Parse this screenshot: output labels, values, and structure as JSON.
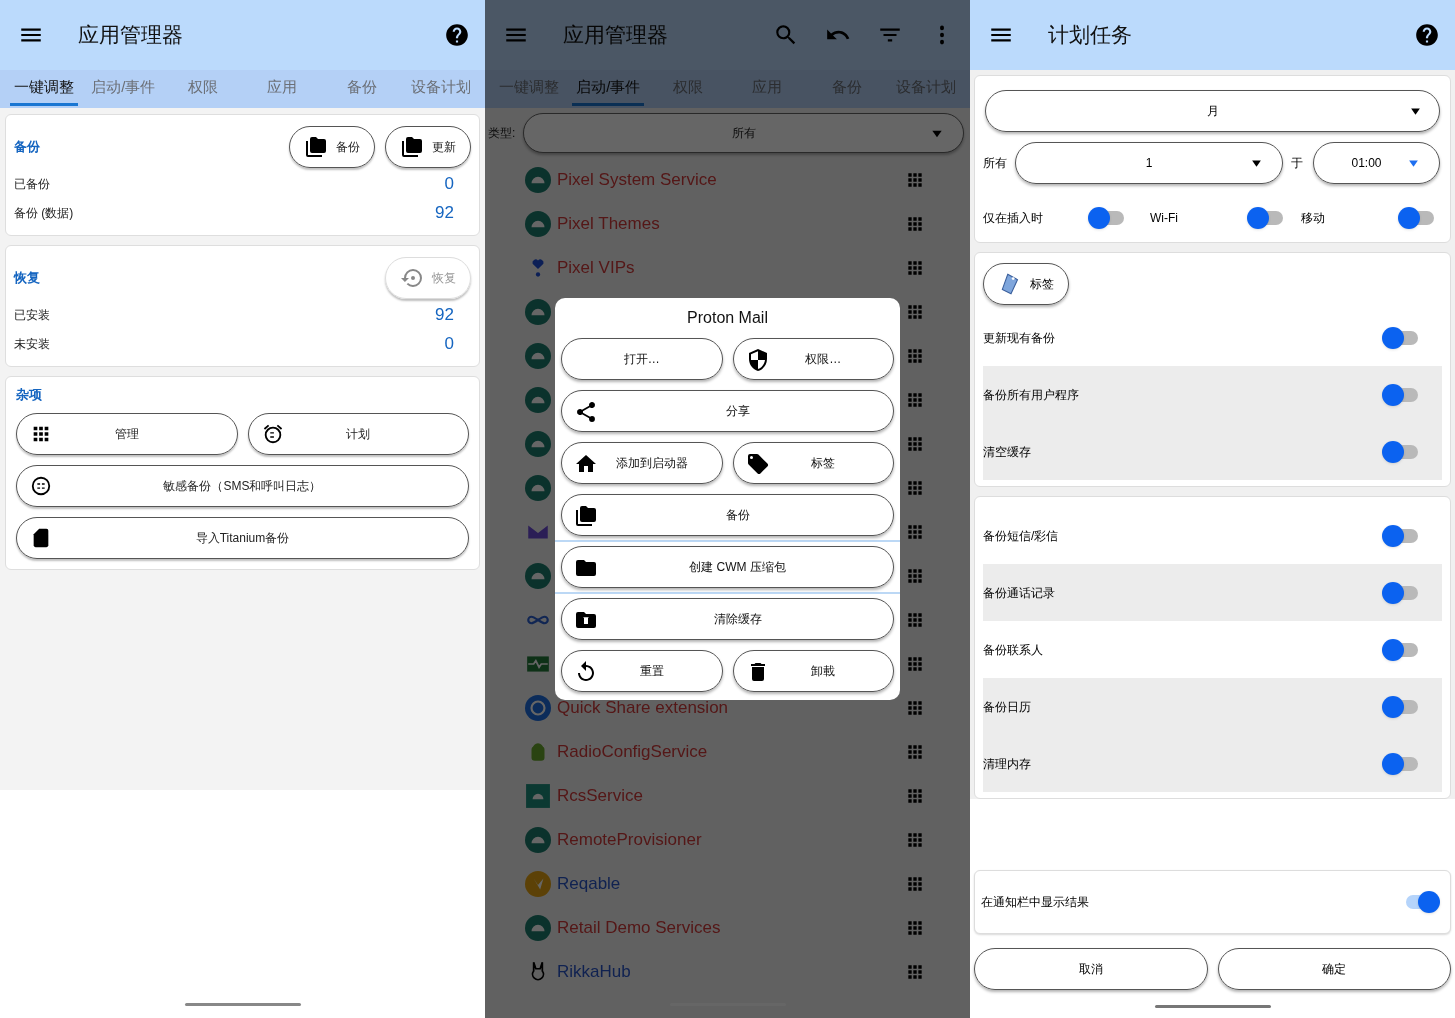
{
  "main_screen": {
    "title": "应用管理器",
    "tabs": [
      {
        "label": "一键调整",
        "selected": true
      },
      {
        "label": "启动/事件",
        "selected": false
      },
      {
        "label": "权限",
        "selected": false
      },
      {
        "label": "应用",
        "selected": false
      },
      {
        "label": "备份",
        "selected": false
      },
      {
        "label": "设备计划",
        "selected": false
      }
    ],
    "backup_card": {
      "heading": "备份",
      "buttons": [
        {
          "label": "备份",
          "disabled": false
        },
        {
          "label": "更新",
          "disabled": false
        }
      ],
      "stats": [
        {
          "label": "已备份",
          "value": "0"
        },
        {
          "label": "备份 (数据)",
          "value": "92"
        }
      ]
    },
    "restore_card": {
      "heading": "恢复",
      "buttons": [
        {
          "label": "恢复",
          "disabled": true
        }
      ],
      "stats": [
        {
          "label": "已安装",
          "value": "92"
        },
        {
          "label": "未安装",
          "value": "0"
        }
      ]
    },
    "misc_card": {
      "heading": "杂项",
      "rows": [
        [
          {
            "label": "管理"
          },
          {
            "label": "计划"
          }
        ],
        [
          {
            "label": "敏感备份（SMS和呼叫日志）"
          }
        ],
        [
          {
            "label": "导入Titanium备份"
          }
        ]
      ]
    }
  },
  "app_list_screen": {
    "title": "应用管理器",
    "tabs": [
      {
        "label": "一键调整",
        "selected": false
      },
      {
        "label": "启动/事件",
        "selected": true
      },
      {
        "label": "权限",
        "selected": false
      },
      {
        "label": "应用",
        "selected": false
      },
      {
        "label": "备份",
        "selected": false
      },
      {
        "label": "设备计划",
        "selected": false
      }
    ],
    "filter": {
      "label": "类型:",
      "value": "所有"
    },
    "apps": [
      {
        "kind": "android",
        "name": "Pixel System Service",
        "system": true
      },
      {
        "kind": "android",
        "name": "Pixel Themes",
        "system": true
      },
      {
        "kind": "heart",
        "name": "Pixel VIPs",
        "system": true
      },
      {
        "kind": "android"
      },
      {
        "kind": "android"
      },
      {
        "kind": "android"
      },
      {
        "kind": "android"
      },
      {
        "kind": "android"
      },
      {
        "kind": "mail"
      },
      {
        "kind": "android"
      },
      {
        "kind": "infinity"
      },
      {
        "kind": "pulse"
      },
      {
        "kind": "share",
        "name": "Quick Share extension",
        "system": true
      },
      {
        "kind": "robot",
        "name": "RadioConfigService",
        "system": true
      },
      {
        "kind": "square",
        "name": "RcsService",
        "system": true
      },
      {
        "kind": "android",
        "name": "RemoteProvisioner",
        "system": true
      },
      {
        "kind": "bird",
        "name": "Reqable",
        "system": false
      },
      {
        "kind": "android",
        "name": "Retail Demo Services",
        "system": true
      },
      {
        "kind": "rabbit",
        "name": "RikkaHub",
        "system": false
      }
    ],
    "dialog": {
      "title": "Proton Mail",
      "sections": [
        [
          [
            {
              "label": "打开…"
            },
            {
              "label": "权限…"
            }
          ],
          [
            {
              "label": "分享"
            }
          ],
          [
            {
              "label": "添加到启动器"
            },
            {
              "label": "标签"
            }
          ],
          [
            {
              "label": "备份"
            }
          ]
        ],
        [
          [
            {
              "label": "创建 CWM 压缩包"
            }
          ]
        ],
        [
          [
            {
              "label": "清除缓存"
            }
          ],
          [
            {
              "label": "重置"
            },
            {
              "label": "卸載"
            }
          ]
        ]
      ]
    }
  },
  "schedule_screen": {
    "title": "计划任务",
    "frequency": "月",
    "every_label": "所有",
    "every_value": "1",
    "at_label": "于",
    "time": "01:00",
    "conditions": [
      {
        "label": "仅在插入时",
        "on": false
      },
      {
        "label": "Wi-Fi",
        "on": false
      },
      {
        "label": "移动",
        "on": false
      }
    ],
    "tags_button": "标签",
    "option_groups": [
      [
        {
          "label": "更新现有备份",
          "on": false,
          "highlighted": false
        },
        {
          "label": "备份所有用户程序",
          "on": false,
          "highlighted": true
        },
        {
          "label": "清空缓存",
          "on": false,
          "highlighted": true
        }
      ],
      [
        {
          "label": "备份短信/彩信",
          "on": false,
          "highlighted": false
        },
        {
          "label": "备份通话记录",
          "on": false,
          "highlighted": true
        },
        {
          "label": "备份联系人",
          "on": false,
          "highlighted": false
        },
        {
          "label": "备份日历",
          "on": false,
          "highlighted": true
        },
        {
          "label": "清理内存",
          "on": false,
          "highlighted": true
        }
      ]
    ],
    "notify": {
      "label": "在通知栏中显示结果",
      "on": true
    },
    "buttons": [
      {
        "label": "取消"
      },
      {
        "label": "确定"
      }
    ]
  }
}
